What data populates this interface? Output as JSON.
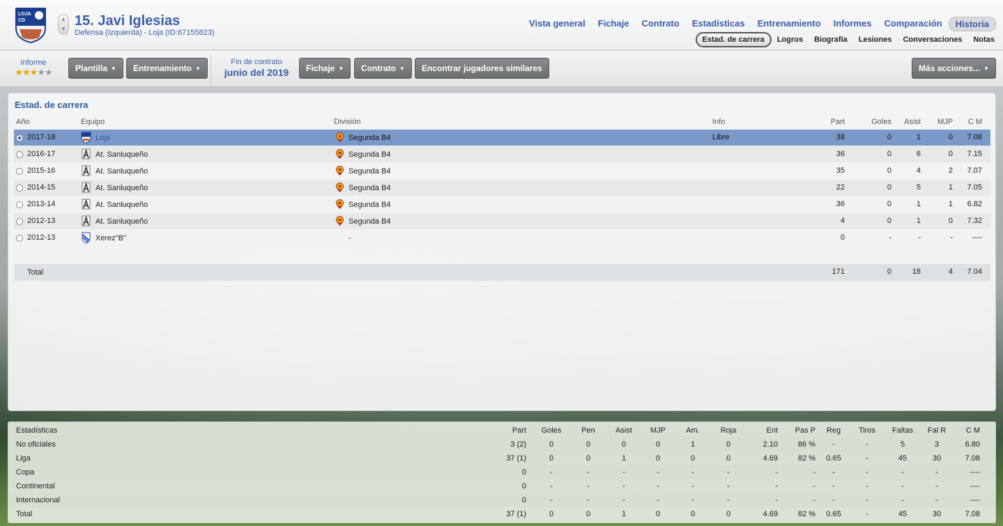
{
  "player": {
    "name": "15. Javi Iglesias",
    "subtitle": "Defensa (Izquierda) - Loja (ID:67155823)",
    "club_badge_text": [
      "LOJA",
      "CD"
    ]
  },
  "topnav": [
    "Vista general",
    "Fichaje",
    "Contrato",
    "Estadísticas",
    "Entrenamiento",
    "Informes",
    "Comparación",
    "Historia"
  ],
  "topnav_active": "Historia",
  "subnav": [
    "Estad. de carrera",
    "Logros",
    "Biografía",
    "Lesiones",
    "Conversaciones",
    "Notas"
  ],
  "subnav_active": "Estad. de carrera",
  "toolbar": {
    "informe_label": "Informe",
    "stars_filled": 3,
    "stars_total": 5,
    "plantilla": "Plantilla",
    "entrenamiento": "Entrenamiento",
    "contract_label": "Fin de contrato",
    "contract_date": "junio del 2019",
    "fichaje": "Fichaje",
    "contrato": "Contrato",
    "similares": "Encontrar jugadores similares",
    "mas": "Más acciones..."
  },
  "career": {
    "title": "Estad. de carrera",
    "headers": {
      "year": "Año",
      "team": "Equipo",
      "division": "División",
      "info": "Info",
      "part": "Part",
      "goles": "Goles",
      "asist": "Asist",
      "mjp": "MJP",
      "cm": "C M"
    },
    "rows": [
      {
        "year": "2017-18",
        "team": "Loja",
        "division": "Segunda B4",
        "info": "Libre",
        "part": "38",
        "goles": "0",
        "asist": "1",
        "mjp": "0",
        "cm": "7.08"
      },
      {
        "year": "2016-17",
        "team": "At. Sanluqueño",
        "division": "Segunda B4",
        "info": "",
        "part": "36",
        "goles": "0",
        "asist": "6",
        "mjp": "0",
        "cm": "7.15"
      },
      {
        "year": "2015-16",
        "team": "At. Sanluqueño",
        "division": "Segunda B4",
        "info": "",
        "part": "35",
        "goles": "0",
        "asist": "4",
        "mjp": "2",
        "cm": "7.07"
      },
      {
        "year": "2014-15",
        "team": "At. Sanluqueño",
        "division": "Segunda B4",
        "info": "",
        "part": "22",
        "goles": "0",
        "asist": "5",
        "mjp": "1",
        "cm": "7.05"
      },
      {
        "year": "2013-14",
        "team": "At. Sanluqueño",
        "division": "Segunda B4",
        "info": "",
        "part": "36",
        "goles": "0",
        "asist": "1",
        "mjp": "1",
        "cm": "6.82"
      },
      {
        "year": "2012-13",
        "team": "At. Sanluqueño",
        "division": "Segunda B4",
        "info": "",
        "part": "4",
        "goles": "0",
        "asist": "1",
        "mjp": "0",
        "cm": "7.32"
      },
      {
        "year": "2012-13",
        "team": "Xerez\"B\"",
        "division": "-",
        "info": "",
        "part": "0",
        "goles": "-",
        "asist": "-",
        "mjp": "-",
        "cm": "----"
      }
    ],
    "total": {
      "label": "Total",
      "part": "171",
      "goles": "0",
      "asist": "18",
      "mjp": "4",
      "cm": "7.04"
    }
  },
  "stats": {
    "headers": [
      "Estadísticas",
      "Part",
      "Goles",
      "Pen",
      "Asist",
      "MJP",
      "Am.",
      "Roja",
      "Ent",
      "Pas P",
      "Reg",
      "Tiros",
      "Faltas",
      "Fal R",
      "C M"
    ],
    "rows": [
      [
        "No oficiales",
        "3 (2)",
        "0",
        "0",
        "0",
        "0",
        "1",
        "0",
        "2.10",
        "86 %",
        "-",
        "-",
        "5",
        "3",
        "6.80"
      ],
      [
        "Liga",
        "37 (1)",
        "0",
        "0",
        "1",
        "0",
        "0",
        "0",
        "4.69",
        "82 %",
        "0.65",
        "-",
        "45",
        "30",
        "7.08"
      ],
      [
        "Copa",
        "0",
        "-",
        "-",
        "-",
        "-",
        "-",
        "-",
        "-",
        "-",
        "-",
        "-",
        "-",
        "-",
        "----"
      ],
      [
        "Continental",
        "0",
        "-",
        "-",
        "-",
        "-",
        "-",
        "-",
        "-",
        "-",
        "-",
        "-",
        "-",
        "-",
        "----"
      ],
      [
        "Internacional",
        "0",
        "-",
        "-",
        "-",
        "-",
        "-",
        "-",
        "-",
        "-",
        "-",
        "-",
        "-",
        "-",
        "----"
      ],
      [
        "Total",
        "37 (1)",
        "0",
        "0",
        "1",
        "0",
        "0",
        "0",
        "4.69",
        "82 %",
        "0.65",
        "-",
        "45",
        "30",
        "7.08"
      ]
    ]
  }
}
